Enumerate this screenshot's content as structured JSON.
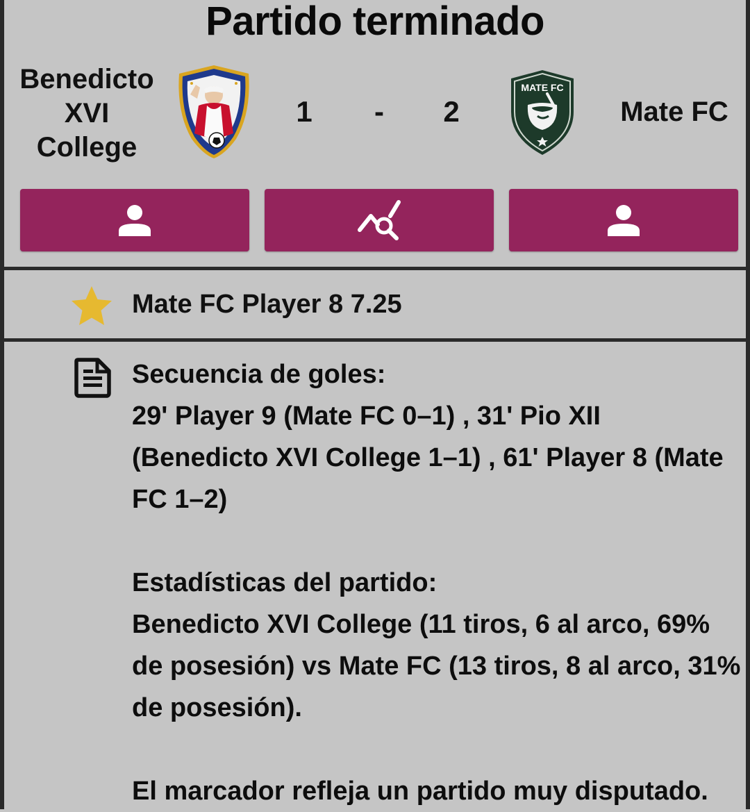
{
  "header": {
    "title": "Partido terminado"
  },
  "match": {
    "home_team": "Benedicto XVI College",
    "away_team": "Mate FC",
    "home_score": "1",
    "separator": "-",
    "away_score": "2",
    "away_crest_text": "MATE FC"
  },
  "actions": {
    "home_lineup_icon": "person-icon",
    "stats_icon": "chart-search-icon",
    "away_lineup_icon": "person-icon",
    "button_color": "#94245c"
  },
  "mvp": {
    "icon": "star-icon",
    "text": "Mate FC Player 8 7.25",
    "star_color": "#e6b930"
  },
  "summary": {
    "icon": "document-icon",
    "goals_heading": "Secuencia de goles:",
    "goals_text": "29' Player 9 (Mate FC 0–1) , 31' Pio XII (Benedicto XVI College 1–1) , 61' Player 8 (Mate FC 1–2)",
    "stats_heading": "Estadísticas del partido:",
    "stats_text": "Benedicto XVI College (11 tiros, 6 al arco, 69% de posesión) vs Mate FC (13 tiros, 8 al arco, 31% de posesión).",
    "closing": "El marcador refleja un partido muy disputado."
  }
}
